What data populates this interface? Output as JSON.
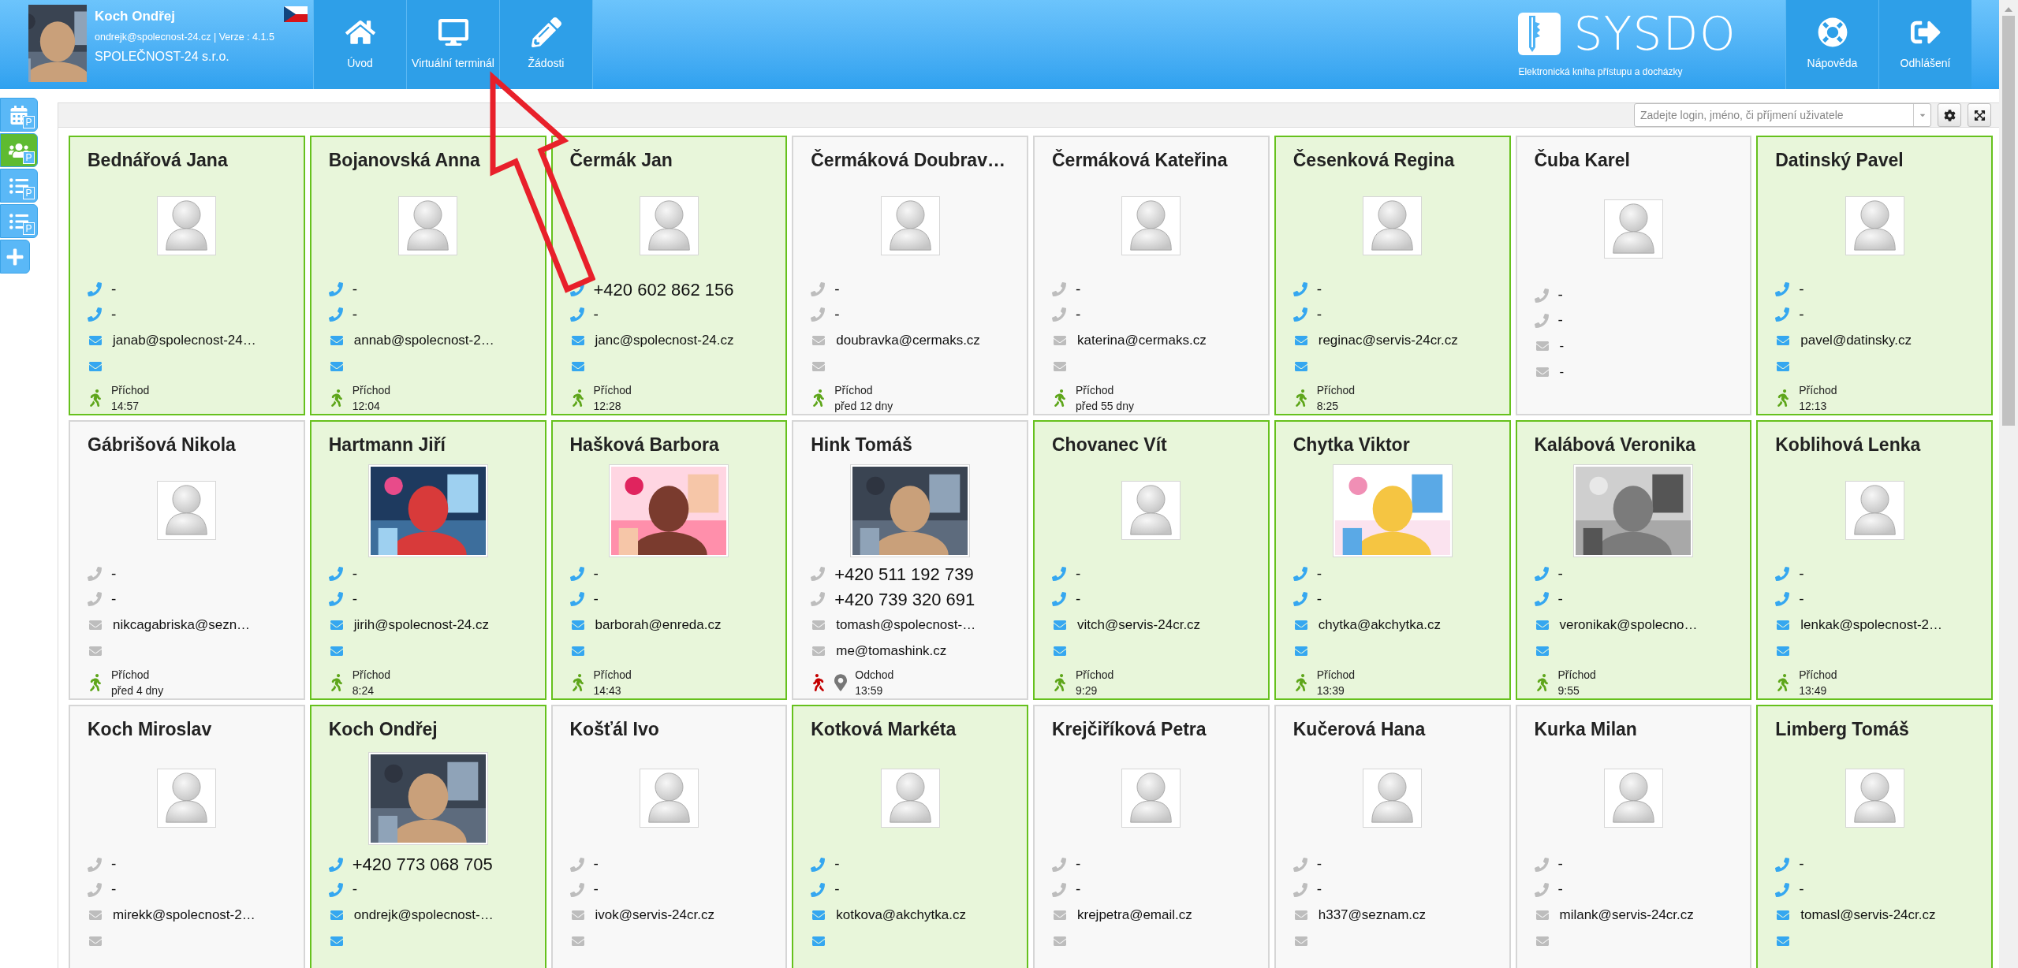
{
  "header": {
    "user": {
      "name": "Koch Ondřej",
      "email_version": "ondrejk@spolecnost-24.cz | Verze : 4.1.5",
      "company": "SPOLEČNOST-24 s.r.o.",
      "photo": {
        "kind": "picture"
      }
    },
    "nav": [
      {
        "label": "Úvod"
      },
      {
        "label": "Virtuální terminál"
      },
      {
        "label": "Žádosti"
      }
    ],
    "logo": {
      "name": "SYSDO",
      "tagline": "Elektronická kniha přístupu a docházky"
    },
    "actions": [
      {
        "label": "Nápověda"
      },
      {
        "label": "Odhlášení"
      }
    ]
  },
  "sidebar": [
    {
      "badge": "P",
      "selected": false
    },
    {
      "badge": "P",
      "selected": true
    },
    {
      "badge": "P",
      "selected": false
    },
    {
      "badge": "P",
      "selected": false
    },
    {
      "selected": false
    }
  ],
  "toolbar": {
    "search": {
      "placeholder": "Zadejte login, jméno, či příjmení uživatele"
    }
  },
  "cards": [
    {
      "name": "Bednářová Jana",
      "present": true,
      "phones": [
        "-",
        "-"
      ],
      "emails": [
        "janab@spolecnost-24…"
      ],
      "status": {
        "kind": "arrival",
        "label": "Příchod",
        "time": "14:57"
      }
    },
    {
      "name": "Bojanovská Anna",
      "present": true,
      "phones": [
        "-",
        "-"
      ],
      "emails": [
        "annab@spolecnost-2…"
      ],
      "status": {
        "kind": "arrival",
        "label": "Příchod",
        "time": "12:04"
      }
    },
    {
      "name": "Čermák Jan",
      "present": true,
      "phones": [
        "+420 602 862 156",
        "-"
      ],
      "emails": [
        "janc@spolecnost-24.cz"
      ],
      "status": {
        "kind": "arrival",
        "label": "Příchod",
        "time": "12:28"
      }
    },
    {
      "name": "Čermáková Doubrav…",
      "present": false,
      "phones": [
        "-",
        "-"
      ],
      "emails": [
        "doubravka@cermaks.cz"
      ],
      "status": {
        "kind": "arrival",
        "label": "Příchod",
        "time": "před 12 dny"
      }
    },
    {
      "name": "Čermáková Kateřina",
      "present": false,
      "phones": [
        "-",
        "-"
      ],
      "emails": [
        "katerina@cermaks.cz"
      ],
      "status": {
        "kind": "arrival",
        "label": "Příchod",
        "time": "před 55 dny"
      }
    },
    {
      "name": "Česenková Regina",
      "present": true,
      "phones": [
        "-",
        "-"
      ],
      "emails": [
        "reginac@servis-24cr.cz"
      ],
      "status": {
        "kind": "arrival",
        "label": "Příchod",
        "time": "8:25"
      }
    },
    {
      "name": "Čuba Karel",
      "present": false,
      "phones": [
        "-",
        "-"
      ],
      "emails": [
        "-",
        "-"
      ]
    },
    {
      "name": "Datinský Pavel",
      "present": true,
      "phones": [
        "-",
        "-"
      ],
      "emails": [
        "pavel@datinsky.cz"
      ],
      "status": {
        "kind": "arrival",
        "label": "Příchod",
        "time": "12:13"
      }
    },
    {
      "name": "Gábrišová Nikola",
      "present": false,
      "phones": [
        "-",
        "-"
      ],
      "emails": [
        "nikcagabriska@sezn…"
      ],
      "status": {
        "kind": "arrival",
        "label": "Příchod",
        "time": "před 4 dny"
      }
    },
    {
      "name": "Hartmann Jiří",
      "present": true,
      "photo": {
        "kind": "picture"
      },
      "phones": [
        "-",
        "-"
      ],
      "emails": [
        "jirih@spolecnost-24.cz"
      ],
      "status": {
        "kind": "arrival",
        "label": "Příchod",
        "time": "8:24"
      }
    },
    {
      "name": "Hašková Barbora",
      "present": true,
      "photo": {
        "kind": "picture"
      },
      "phones": [
        "-",
        "-"
      ],
      "emails": [
        "barborah@enreda.cz"
      ],
      "status": {
        "kind": "arrival",
        "label": "Příchod",
        "time": "14:43"
      }
    },
    {
      "name": "Hink Tomáš",
      "present": false,
      "photo": {
        "kind": "picture"
      },
      "phones": [
        "+420 511 192 739",
        "+420 739 320 691"
      ],
      "emails": [
        "tomash@spolecnost-…",
        "me@tomashink.cz"
      ],
      "status": {
        "kind": "departure",
        "label": "Odchod",
        "time": "13:59"
      }
    },
    {
      "name": "Chovanec Vít",
      "present": true,
      "phones": [
        "-",
        "-"
      ],
      "emails": [
        "vitch@servis-24cr.cz"
      ],
      "status": {
        "kind": "arrival",
        "label": "Příchod",
        "time": "9:29"
      }
    },
    {
      "name": "Chytka Viktor",
      "present": true,
      "photo": {
        "kind": "picture"
      },
      "phones": [
        "-",
        "-"
      ],
      "emails": [
        "chytka@akchytka.cz"
      ],
      "status": {
        "kind": "arrival",
        "label": "Příchod",
        "time": "13:39"
      }
    },
    {
      "name": "Kalábová Veronika",
      "present": true,
      "photo": {
        "kind": "picture"
      },
      "phones": [
        "-",
        "-"
      ],
      "emails": [
        "veronikak@spolecno…"
      ],
      "status": {
        "kind": "arrival",
        "label": "Příchod",
        "time": "9:55"
      }
    },
    {
      "name": "Koblihová Lenka",
      "present": true,
      "phones": [
        "-",
        "-"
      ],
      "emails": [
        "lenkak@spolecnost-2…"
      ],
      "status": {
        "kind": "arrival",
        "label": "Příchod",
        "time": "13:49"
      }
    },
    {
      "name": "Koch Miroslav",
      "present": false,
      "phones": [
        "-",
        "-"
      ],
      "emails": [
        "mirekk@spolecnost-2…"
      ]
    },
    {
      "name": "Koch Ondřej",
      "present": true,
      "photo": {
        "kind": "picture"
      },
      "phones": [
        "+420 773 068 705",
        "-"
      ],
      "emails": [
        "ondrejk@spolecnost-…"
      ]
    },
    {
      "name": "Košťál Ivo",
      "present": false,
      "phones": [
        "-",
        "-"
      ],
      "emails": [
        "ivok@servis-24cr.cz"
      ]
    },
    {
      "name": "Kotková Markéta",
      "present": true,
      "phones": [
        "-",
        "-"
      ],
      "emails": [
        "kotkova@akchytka.cz"
      ]
    },
    {
      "name": "Krejčiříková Petra",
      "present": false,
      "phones": [
        "-",
        "-"
      ],
      "emails": [
        "krejpetra@email.cz"
      ]
    },
    {
      "name": "Kučerová Hana",
      "present": false,
      "phones": [
        "-",
        "-"
      ],
      "emails": [
        "h337@seznam.cz"
      ]
    },
    {
      "name": "Kurka Milan",
      "present": false,
      "phones": [
        "-",
        "-"
      ],
      "emails": [
        "milank@servis-24cr.cz"
      ]
    },
    {
      "name": "Limberg Tomáš",
      "present": true,
      "phones": [
        "-",
        "-"
      ],
      "emails": [
        "tomasl@servis-24cr.cz"
      ]
    }
  ]
}
